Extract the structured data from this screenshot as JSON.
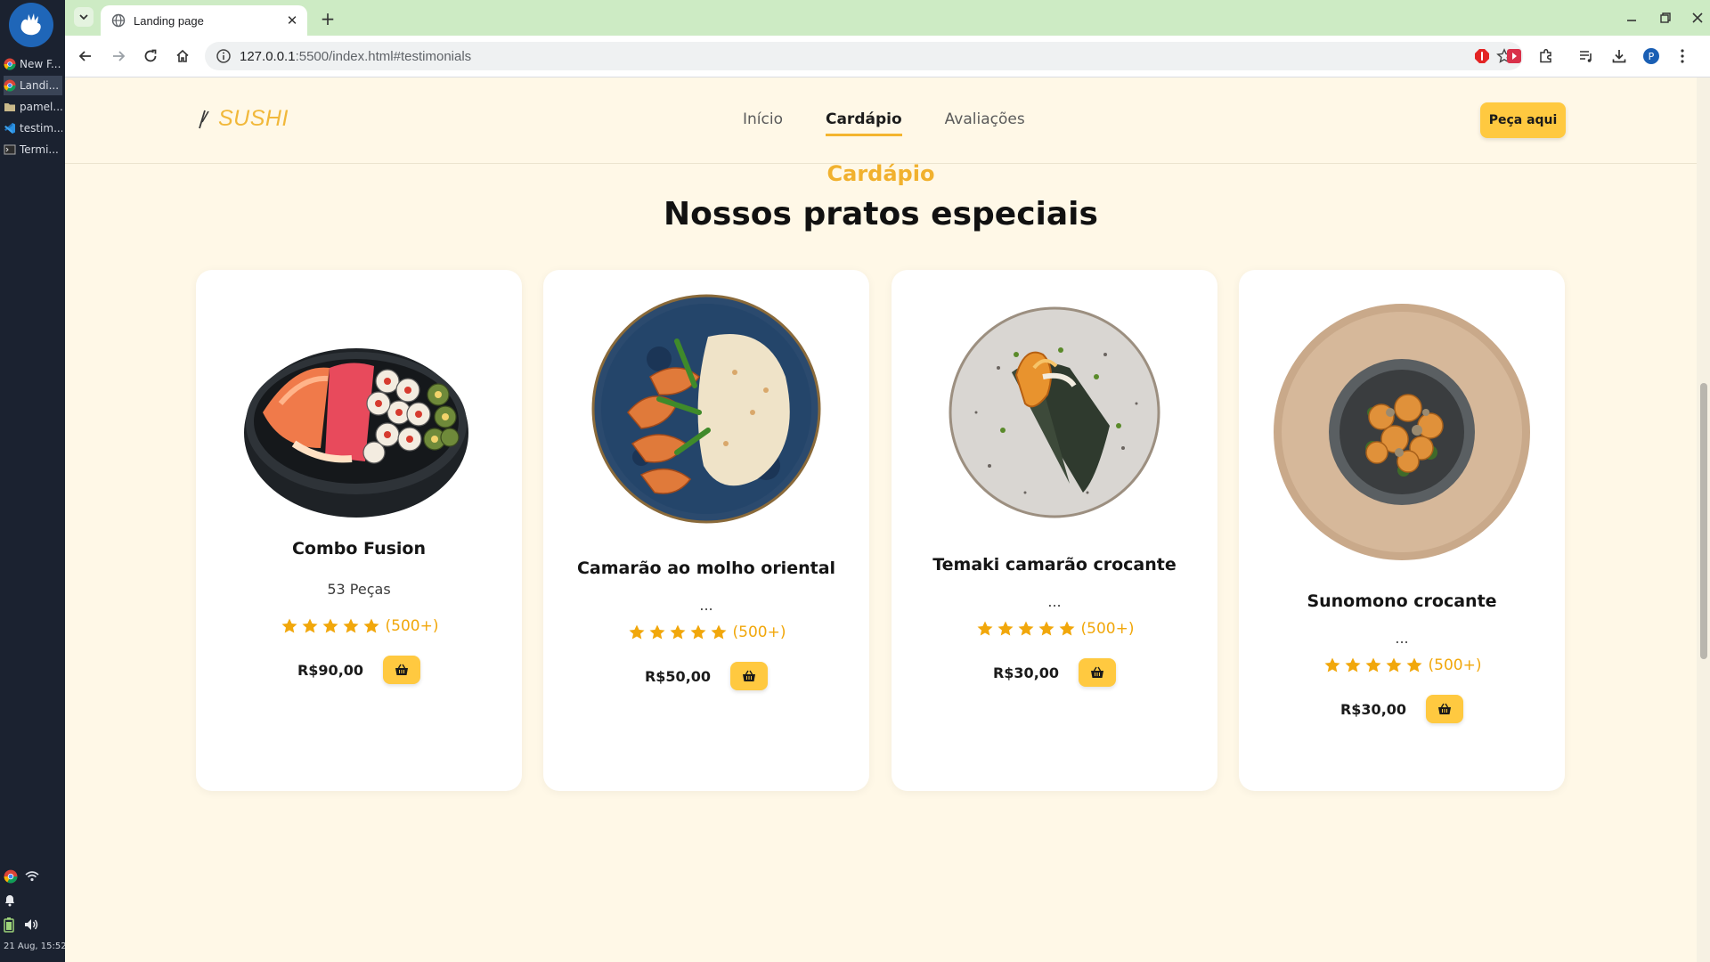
{
  "os": {
    "tasks": [
      {
        "label": "New F...",
        "icon": "chrome-icon"
      },
      {
        "label": "Landi...",
        "icon": "chrome-icon"
      },
      {
        "label": "pamel...",
        "icon": "folder-icon"
      },
      {
        "label": "testim...",
        "icon": "vscode-icon"
      },
      {
        "label": "Termi...",
        "icon": "terminal-icon"
      }
    ],
    "clock": "21 Aug, 15:52"
  },
  "browser": {
    "tab_title": "Landing page",
    "url_host": "127.0.0.1",
    "url_path": ":5500/index.html#testimonials"
  },
  "site": {
    "logo_text": "SUSHI",
    "nav": [
      {
        "label": "Início"
      },
      {
        "label": "Cardápio"
      },
      {
        "label": "Avaliações"
      }
    ],
    "nav_active": "Cardápio",
    "cta_label": "Peça aqui"
  },
  "menu": {
    "kicker": "Cardápio",
    "title": "Nossos pratos especiais",
    "dishes": [
      {
        "name": "Combo Fusion",
        "desc": "53 Peças",
        "rating_stars": 5,
        "rating_count": "(500+)",
        "price": "R$90,00"
      },
      {
        "name": "Camarão ao molho oriental",
        "desc": "...",
        "rating_stars": 5,
        "rating_count": "(500+)",
        "price": "R$50,00"
      },
      {
        "name": "Temaki camarão crocante",
        "desc": "...",
        "rating_stars": 5,
        "rating_count": "(500+)",
        "price": "R$30,00"
      },
      {
        "name": "Sunomono crocante",
        "desc": "...",
        "rating_stars": 5,
        "rating_count": "(500+)",
        "price": "R$30,00"
      }
    ]
  },
  "colors": {
    "accent": "#ffc940",
    "kicker": "#f1b12e",
    "star": "#f1a70b",
    "page_bg": "#fff8e7"
  }
}
